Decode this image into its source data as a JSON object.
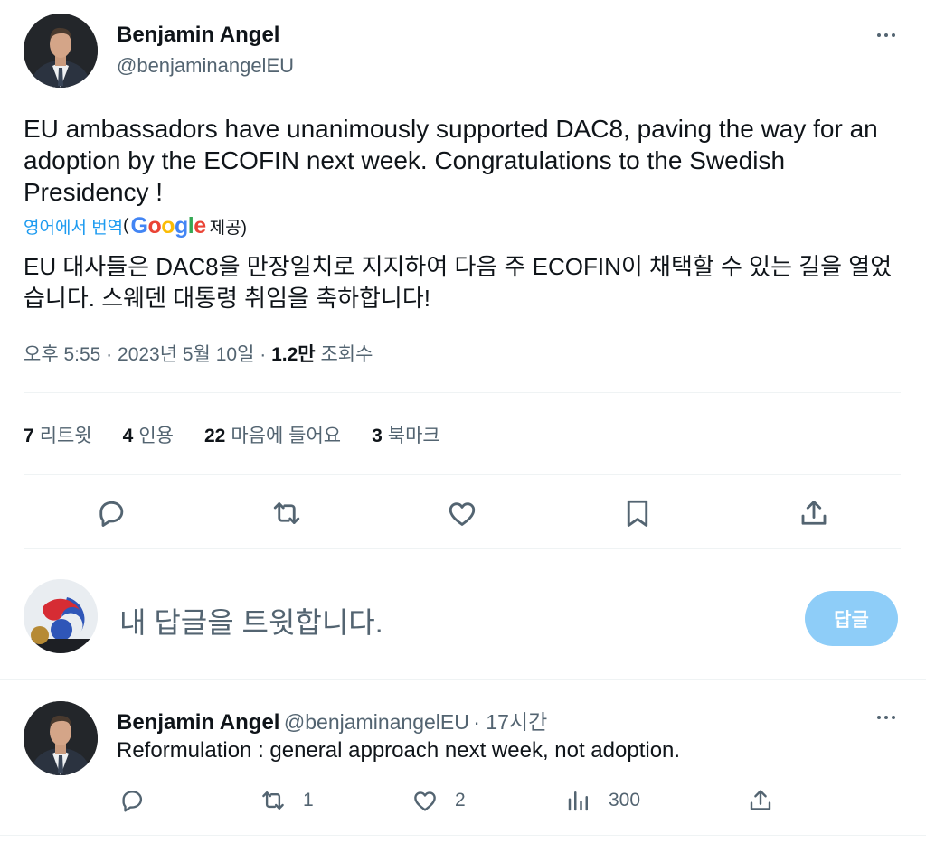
{
  "tweet": {
    "author_name": "Benjamin Angel",
    "author_handle": "@benjaminangelEU",
    "text": "EU ambassadors have unanimously supported DAC8, paving the way for an adoption by the ECOFIN next week. Congratulations to the  Swedish Presidency !",
    "translated_label": "영어에서 번역",
    "translated_open": "(",
    "translated_provider": "Google",
    "translated_suffix": "제공)",
    "translated_text": "EU 대사들은 DAC8을 만장일치로 지지하여 다음 주 ECOFIN이 채택할 수 있는 길을 열었습니다. 스웨덴 대통령 취임을 축하합니다!",
    "timestamp": "오후 5:55 · 2023년 5월 10일",
    "sep": "·",
    "views_count": "1.2만",
    "views_label": "조회수"
  },
  "stats": {
    "retweets_count": "7",
    "retweets_label": "리트윗",
    "quotes_count": "4",
    "quotes_label": "인용",
    "likes_count": "22",
    "likes_label": "마음에 들어요",
    "bookmarks_count": "3",
    "bookmarks_label": "북마크"
  },
  "icons": {
    "more": "more-icon",
    "reply": "reply-icon",
    "retweet": "retweet-icon",
    "like": "heart-icon",
    "bookmark": "bookmark-icon",
    "share": "share-icon",
    "views": "views-icon"
  },
  "composer": {
    "placeholder": "내 답글을 트윗합니다.",
    "button_label": "답글"
  },
  "reply": {
    "author_name": "Benjamin Angel",
    "author_handle": "@benjaminangelEU",
    "time": "· 17시간",
    "text": "Reformulation : general approach next week, not adoption.",
    "retweets": "1",
    "likes": "2",
    "views": "300"
  },
  "colors": {
    "accent": "#1d9bf0",
    "reply_button": "#8ecdf8",
    "secondary_text": "#536471",
    "google_blue": "#4285f4",
    "google_red": "#ea4335",
    "google_yellow": "#fbbc05",
    "google_green": "#34a853"
  }
}
